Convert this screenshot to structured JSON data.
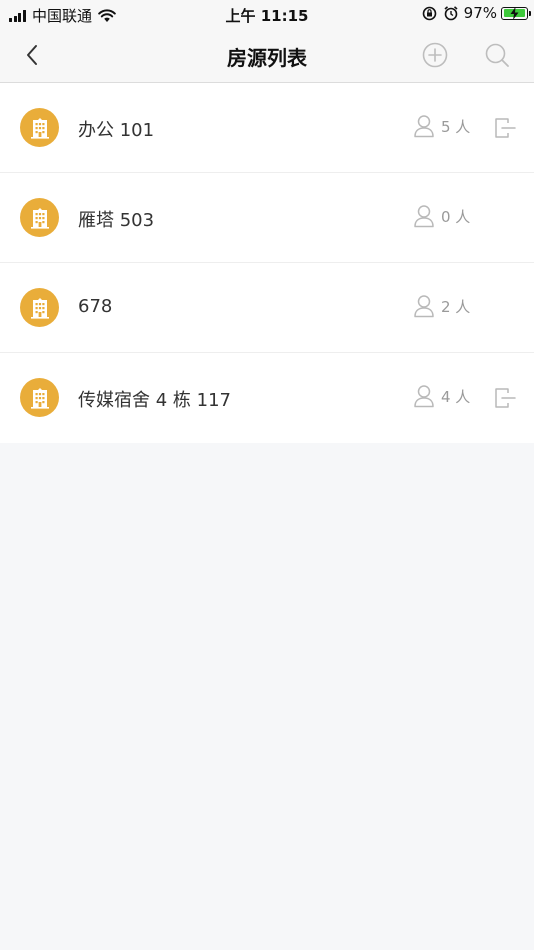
{
  "status_bar": {
    "carrier": "中国联通",
    "time": "上午 11:15",
    "battery_percent": "97%",
    "battery_level": 0.97
  },
  "nav": {
    "title": "房源列表",
    "back_icon": "chevron-left-icon",
    "add_icon": "plus-circle-icon",
    "search_icon": "search-icon"
  },
  "rooms": [
    {
      "name": "办公 101",
      "occupants": "5 人",
      "has_door_icon": true
    },
    {
      "name": "雁塔 503",
      "occupants": "0 人",
      "has_door_icon": false
    },
    {
      "name": "678",
      "occupants": "2 人",
      "has_door_icon": false
    },
    {
      "name": "传媒宿舍 4 栋 117",
      "occupants": "4 人",
      "has_door_icon": true
    }
  ],
  "colors": {
    "accent": "#e9ad3a",
    "muted": "#9a9a9a",
    "page_bg": "#f6f7f9",
    "battery_fill": "#3ec93b"
  }
}
